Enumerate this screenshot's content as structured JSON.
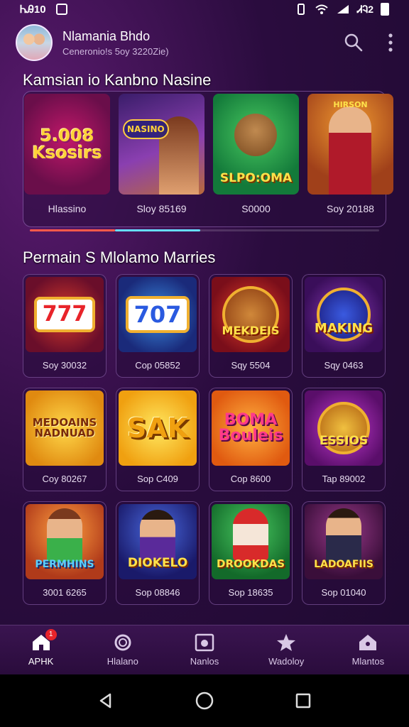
{
  "status_bar": {
    "time": "ᏂᎯ10",
    "right_text": "ᏗᎸ2"
  },
  "header": {
    "user_name": "Nlamania Bhdo",
    "user_sub": "Ceneronio!s 5oy 3220Zie)"
  },
  "featured": {
    "title": "Kamsian io Kanbno Nasine",
    "items": [
      {
        "caption": "Hlassino",
        "art": "5.008 Ksosirs"
      },
      {
        "caption": "Sloy 85169",
        "art": "NASINO"
      },
      {
        "caption": "S0000",
        "art": "SLPO:OMA"
      },
      {
        "caption": "Soy 20188",
        "art": "HIRSON"
      }
    ]
  },
  "games": {
    "title": "Permain S Mlolamo Marries",
    "items": [
      {
        "caption": "Soy 30032",
        "art": "777"
      },
      {
        "caption": "Cop 05852",
        "art": "707"
      },
      {
        "caption": "Sqy 5504",
        "art": "MEKDEIS"
      },
      {
        "caption": "Sqy 0463",
        "art": "MAKING"
      },
      {
        "caption": "Coy 80267",
        "art": "MEDOAINS NADNUAD"
      },
      {
        "caption": "Sop C409",
        "art": "SAK"
      },
      {
        "caption": "Cop 8600",
        "art": "BOMA Bouleis"
      },
      {
        "caption": "Tap 89002",
        "art": "ESSIOS"
      },
      {
        "caption": "3001 6265",
        "art": "PERMHINS"
      },
      {
        "caption": "Sop 08846",
        "art": "DIOKELO"
      },
      {
        "caption": "Sop 18635",
        "art": "DROOKDAS"
      },
      {
        "caption": "Sop 01040",
        "art": "LADOAFIIS"
      }
    ]
  },
  "bottom_nav": [
    {
      "label": "APHK",
      "badge": "1"
    },
    {
      "label": "Hlalano"
    },
    {
      "label": "Nanlos"
    },
    {
      "label": "Wadoloy"
    },
    {
      "label": "Mlantos"
    }
  ],
  "colors": {
    "accent_red": "#ff5a4a",
    "accent_cyan": "#66ddff",
    "background": "#2a0c3e"
  }
}
